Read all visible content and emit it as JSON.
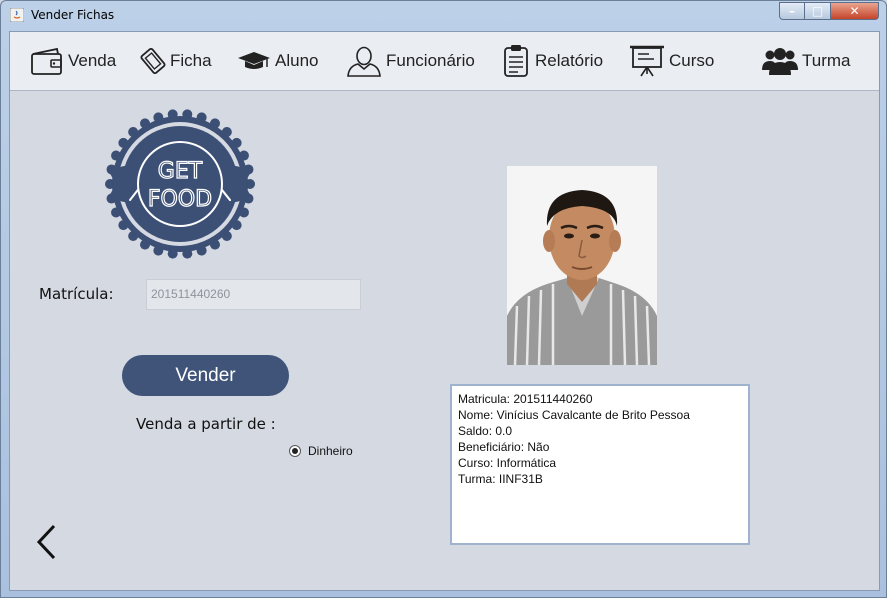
{
  "window": {
    "title": "Vender Fichas"
  },
  "toolbar": {
    "items": [
      {
        "label": "Venda",
        "icon": "wallet-icon"
      },
      {
        "label": "Ficha",
        "icon": "ticket-icon"
      },
      {
        "label": "Aluno",
        "icon": "graduation-cap-icon"
      },
      {
        "label": "Funcionário",
        "icon": "user-outline-icon"
      },
      {
        "label": "Relatório",
        "icon": "clipboard-icon"
      },
      {
        "label": "Curso",
        "icon": "presentation-board-icon"
      },
      {
        "label": "Turma",
        "icon": "group-icon"
      }
    ]
  },
  "logo": {
    "line1": "GET",
    "line2": "FOOD"
  },
  "form": {
    "matricula_label": "Matrícula:",
    "matricula_value": "201511440260",
    "vender_label": "Vender",
    "venda_label": "Venda a partir de :",
    "radio_label": "Dinheiro"
  },
  "info": {
    "lines": [
      "Matricula: 201511440260",
      "Nome: Vinícius Cavalcante de Brito Pessoa",
      "Saldo: 0.0",
      "Beneficiário: Não",
      "Curso: Informática",
      "Turma: IINF31B"
    ]
  },
  "colors": {
    "accent": "#3f5478",
    "logo": "#3c4f75"
  }
}
